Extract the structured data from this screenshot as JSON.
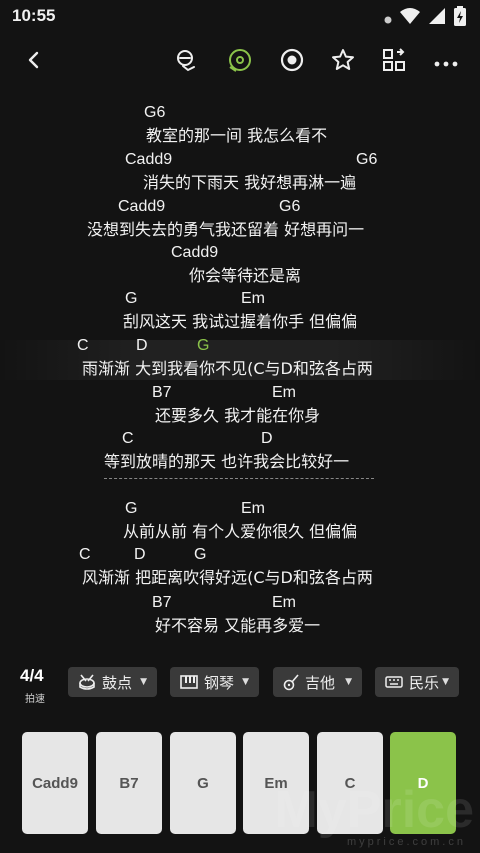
{
  "status": {
    "time": "10:55"
  },
  "toolbar": {
    "icons": [
      "back-icon",
      "tuner-icon",
      "capo-icon",
      "record-icon",
      "star-icon",
      "transpose-icon",
      "more-icon"
    ],
    "accent": "#8bc34a"
  },
  "lyrics": [
    {
      "text": "教室的那一间 我怎么看不",
      "chords": [
        "G6"
      ]
    },
    {
      "text": "消失的下雨天 我好想再淋一遍",
      "chords": [
        "Cadd9",
        "G6"
      ]
    },
    {
      "text": "没想到失去的勇气我还留着 好想再问一",
      "chords": [
        "Cadd9",
        "G6"
      ]
    },
    {
      "text": "你会等待还是离",
      "chords": [
        "Cadd9"
      ]
    },
    {
      "text": "刮风这天 我试过握着你手 但偏偏",
      "chords": [
        "G",
        "Em"
      ]
    },
    {
      "text": "雨渐渐 大到我看你不见(C与D和弦各占两",
      "chords": [
        "C",
        "D",
        "G"
      ]
    },
    {
      "text": "还要多久 我才能在你身",
      "chords": [
        "B7",
        "Em"
      ]
    },
    {
      "text": "等到放晴的那天 也许我会比较好一",
      "chords": [
        "C",
        "D"
      ]
    },
    {
      "text": "从前从前 有个人爱你很久 但偏偏",
      "chords": [
        "G",
        "Em"
      ]
    },
    {
      "text": "风渐渐 把距离吹得好远(C与D和弦各占两",
      "chords": [
        "C",
        "D",
        "G"
      ]
    },
    {
      "text": "好不容易 又能再多爱一",
      "chords": [
        "B7",
        "Em"
      ]
    }
  ],
  "controls": {
    "tempo_value": "4/4",
    "tempo_label": "拍速",
    "drums": "鼓点",
    "piano": "钢琴",
    "guitar": "吉他",
    "style": "民乐"
  },
  "chord_keys": [
    "Cadd9",
    "B7",
    "G",
    "Em",
    "C",
    "D"
  ],
  "active_key": "D",
  "watermark": {
    "main": "MyPrice",
    "sub": "myprice.com.cn"
  }
}
